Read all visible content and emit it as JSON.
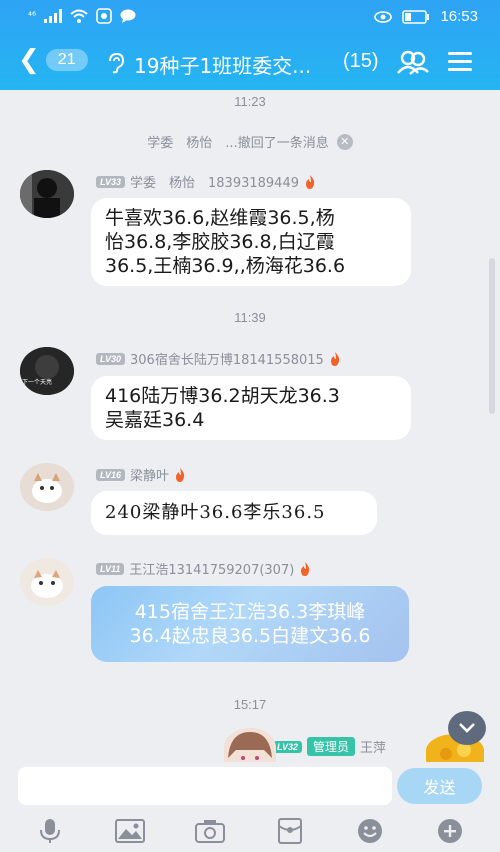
{
  "status_bar": {
    "signal": "⁴⁶",
    "time": "16:53"
  },
  "header": {
    "unread_count": "21",
    "title": "19种子1班班委交...",
    "member_count": "(15)"
  },
  "messages": [
    {
      "type": "timestamp",
      "text": "11:23"
    },
    {
      "type": "recall",
      "text": "学委　杨怡　...撤回了一条消息"
    },
    {
      "type": "message",
      "level": "LV33",
      "sender": "学委　杨怡　18393189449",
      "lines": [
        "牛喜欢36.6,赵维霞36.5,杨",
        "怡36.8,李胶胶36.8,白辽霞",
        "36.5,王楠36.9,,杨海花36.6"
      ]
    },
    {
      "type": "timestamp",
      "text": "11:39"
    },
    {
      "type": "message",
      "level": "LV30",
      "sender": "306宿舍长陆万博18141558015",
      "avatar_caption": "下一个天亮",
      "lines": [
        "416陆万博36.2胡天龙36.3",
        "吴嘉廷36.4"
      ]
    },
    {
      "type": "message",
      "level": "LV16",
      "sender": "梁静叶",
      "lines": [
        "240梁静叶36.6李乐36.5"
      ]
    },
    {
      "type": "message",
      "level": "LV11",
      "sender": "王江浩13141759207(307)",
      "lines": [
        "415宿舍王江浩36.3李琪峰",
        "36.4赵忠良36.5白建文36.6"
      ]
    },
    {
      "type": "timestamp",
      "text": "15:17"
    },
    {
      "type": "message_partial",
      "level": "LV32",
      "role": "管理员",
      "sender": "王萍"
    }
  ],
  "input": {
    "placeholder": "",
    "send_label": "发送"
  },
  "colors": {
    "header": "#2ea3f4",
    "background": "#eceef2",
    "admin_tag": "#37c3a8",
    "send_button": "#a8d7f6",
    "fire": "#f2632a"
  }
}
